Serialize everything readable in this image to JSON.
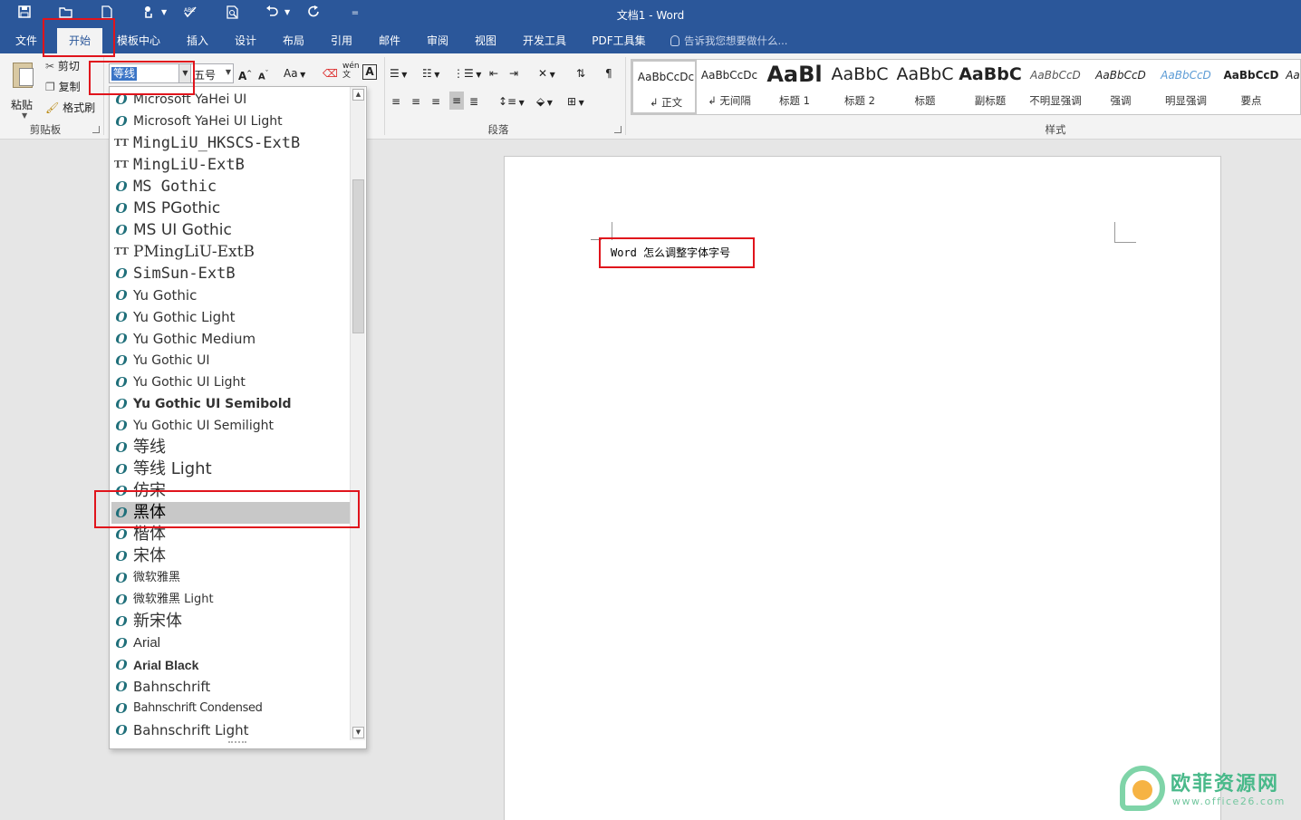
{
  "window": {
    "title": "文档1 - Word"
  },
  "quick_access": {
    "icons": [
      "save-icon",
      "open-icon",
      "new-icon",
      "touch-mode-icon",
      "spelling-icon",
      "print-preview-icon",
      "undo-icon",
      "redo-icon",
      "customize-icon"
    ]
  },
  "tabs": [
    {
      "label": "文件"
    },
    {
      "label": "开始"
    },
    {
      "label": "模板中心"
    },
    {
      "label": "插入"
    },
    {
      "label": "设计"
    },
    {
      "label": "布局"
    },
    {
      "label": "引用"
    },
    {
      "label": "邮件"
    },
    {
      "label": "审阅"
    },
    {
      "label": "视图"
    },
    {
      "label": "开发工具"
    },
    {
      "label": "PDF工具集"
    }
  ],
  "tell_me": {
    "placeholder": "告诉我您想要做什么..."
  },
  "clipboard": {
    "paste": "粘贴",
    "cut": "剪切",
    "copy": "复制",
    "format_painter": "格式刷",
    "group_label": "剪贴板"
  },
  "font": {
    "current_font": "等线",
    "current_size": "五号",
    "change_case": "Aa",
    "phonetic": "wén",
    "char_border": "A"
  },
  "paragraph": {
    "group_label": "段落"
  },
  "styles": {
    "group_label": "样式",
    "items": [
      {
        "preview": "AaBbCcDc",
        "name": "正文"
      },
      {
        "preview": "AaBbCcDc",
        "name": "无间隔"
      },
      {
        "preview": "AaBl",
        "name": "标题 1"
      },
      {
        "preview": "AaBbC",
        "name": "标题 2"
      },
      {
        "preview": "AaBbC",
        "name": "标题"
      },
      {
        "preview": "AaBbC",
        "name": "副标题"
      },
      {
        "preview": "AaBbCcD",
        "name": "不明显强调"
      },
      {
        "preview": "AaBbCcD",
        "name": "强调"
      },
      {
        "preview": "AaBbCcD",
        "name": "明显强调"
      },
      {
        "preview": "AaBbCcD",
        "name": "要点"
      },
      {
        "preview": "Aa",
        "name": ""
      }
    ]
  },
  "font_list": [
    {
      "name": "Microsoft YaHei UI",
      "type": "otf"
    },
    {
      "name": "Microsoft YaHei UI Light",
      "type": "otf"
    },
    {
      "name": "MingLiU_HKSCS-ExtB",
      "type": "ttf"
    },
    {
      "name": "MingLiU-ExtB",
      "type": "ttf"
    },
    {
      "name": "MS Gothic",
      "type": "otf"
    },
    {
      "name": "MS PGothic",
      "type": "otf"
    },
    {
      "name": "MS UI Gothic",
      "type": "otf"
    },
    {
      "name": "PMingLiU-ExtB",
      "type": "ttf"
    },
    {
      "name": "SimSun-ExtB",
      "type": "otf"
    },
    {
      "name": "Yu Gothic",
      "type": "otf"
    },
    {
      "name": "Yu Gothic Light",
      "type": "otf"
    },
    {
      "name": "Yu Gothic Medium",
      "type": "otf"
    },
    {
      "name": "Yu Gothic UI",
      "type": "otf"
    },
    {
      "name": "Yu Gothic UI Light",
      "type": "otf"
    },
    {
      "name": "Yu Gothic UI Semibold",
      "type": "otf"
    },
    {
      "name": "Yu Gothic UI Semilight",
      "type": "otf"
    },
    {
      "name": "等线",
      "type": "otf"
    },
    {
      "name": "等线 Light",
      "type": "otf"
    },
    {
      "name": "仿宋",
      "type": "otf"
    },
    {
      "name": "黑体",
      "type": "otf",
      "selected": true
    },
    {
      "name": "楷体",
      "type": "otf"
    },
    {
      "name": "宋体",
      "type": "otf"
    },
    {
      "name": "微软雅黑",
      "type": "otf"
    },
    {
      "name": "微软雅黑 Light",
      "type": "otf"
    },
    {
      "name": "新宋体",
      "type": "otf"
    },
    {
      "name": "Arial",
      "type": "otf"
    },
    {
      "name": "Arial Black",
      "type": "otf"
    },
    {
      "name": "Bahnschrift",
      "type": "otf"
    },
    {
      "name": "Bahnschrift Condensed",
      "type": "otf"
    },
    {
      "name": "Bahnschrift Light",
      "type": "otf"
    }
  ],
  "document": {
    "text": "Word 怎么调整字体字号"
  },
  "watermark": {
    "title": "欧菲资源网",
    "url": "www.office26.com"
  },
  "colors": {
    "brand": "#2b579a",
    "highlight": "#e0141c"
  }
}
